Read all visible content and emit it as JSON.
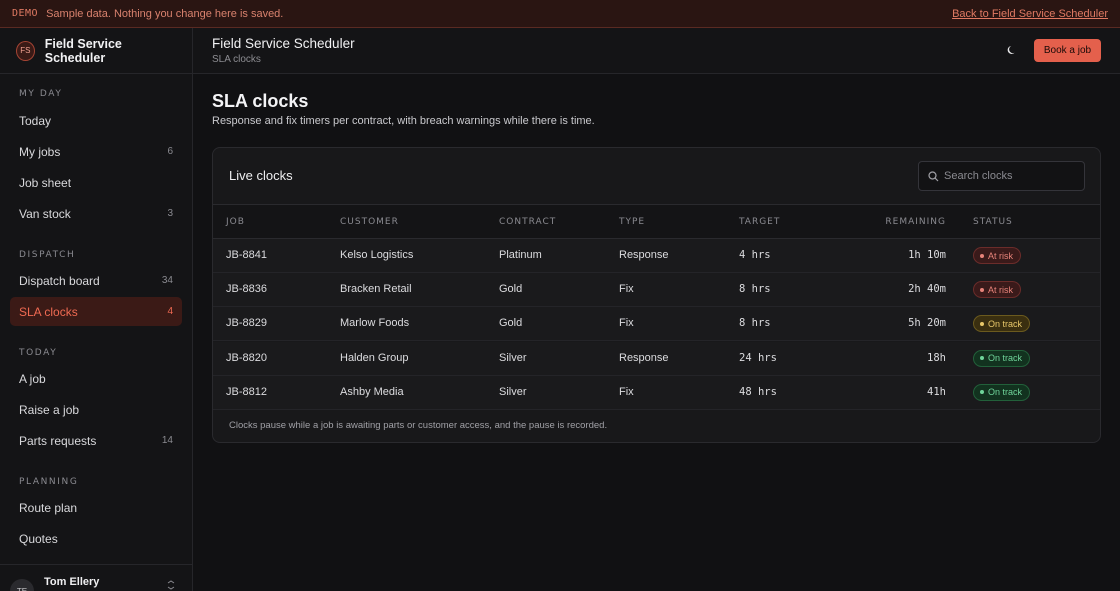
{
  "banner": {
    "tag": "DEMO",
    "message": "Sample data. Nothing you change here is saved.",
    "back_link": "Back to Field Service Scheduler"
  },
  "brand": {
    "initials": "FS",
    "name": "Field Service Scheduler"
  },
  "sidebar": {
    "sections": [
      {
        "label": "MY DAY",
        "items": [
          {
            "label": "Today",
            "count": ""
          },
          {
            "label": "My jobs",
            "count": "6"
          },
          {
            "label": "Job sheet",
            "count": ""
          },
          {
            "label": "Van stock",
            "count": "3"
          }
        ]
      },
      {
        "label": "DISPATCH",
        "items": [
          {
            "label": "Dispatch board",
            "count": "34"
          },
          {
            "label": "SLA clocks",
            "count": "4"
          }
        ]
      },
      {
        "label": "TODAY",
        "items": [
          {
            "label": "A job",
            "count": ""
          },
          {
            "label": "Raise a job",
            "count": ""
          },
          {
            "label": "Parts requests",
            "count": "14"
          }
        ]
      },
      {
        "label": "PLANNING",
        "items": [
          {
            "label": "Route plan",
            "count": ""
          },
          {
            "label": "Quotes",
            "count": ""
          }
        ]
      }
    ],
    "active_item": "SLA clocks"
  },
  "user": {
    "initials": "TE",
    "name": "Tom Ellery",
    "icon": "switch-icon"
  },
  "header": {
    "title": "Field Service Scheduler",
    "subtitle": "SLA clocks",
    "theme_icon": "moon-icon",
    "book_button": "Book a job"
  },
  "page": {
    "title": "SLA clocks",
    "subtitle": "Response and fix timers per contract, with breach warnings while there is time."
  },
  "card": {
    "title": "Live clocks",
    "search_placeholder": "Search clocks",
    "columns": [
      "JOB",
      "CUSTOMER",
      "CONTRACT",
      "TYPE",
      "TARGET",
      "REMAINING",
      "STATUS"
    ],
    "rows": [
      {
        "job": "JB-8841",
        "customer": "Kelso Logistics",
        "contract": "Platinum",
        "type": "Response",
        "target": "4 hrs",
        "remaining": "1h 10m",
        "status": "At risk",
        "tone": "risk"
      },
      {
        "job": "JB-8836",
        "customer": "Bracken Retail",
        "contract": "Gold",
        "type": "Fix",
        "target": "8 hrs",
        "remaining": "2h 40m",
        "status": "At risk",
        "tone": "risk"
      },
      {
        "job": "JB-8829",
        "customer": "Marlow Foods",
        "contract": "Gold",
        "type": "Fix",
        "target": "8 hrs",
        "remaining": "5h 20m",
        "status": "On track",
        "tone": "track-y"
      },
      {
        "job": "JB-8820",
        "customer": "Halden Group",
        "contract": "Silver",
        "type": "Response",
        "target": "24 hrs",
        "remaining": "18h",
        "status": "On track",
        "tone": "track-g"
      },
      {
        "job": "JB-8812",
        "customer": "Ashby Media",
        "contract": "Silver",
        "type": "Fix",
        "target": "48 hrs",
        "remaining": "41h",
        "status": "On track",
        "tone": "track-g"
      }
    ],
    "footnote": "Clocks pause while a job is awaiting parts or customer access, and the pause is recorded."
  },
  "colors": {
    "accent": "#e4604c",
    "risk": "#e7837a",
    "warn": "#e8c86a",
    "ok": "#6fd49a"
  }
}
